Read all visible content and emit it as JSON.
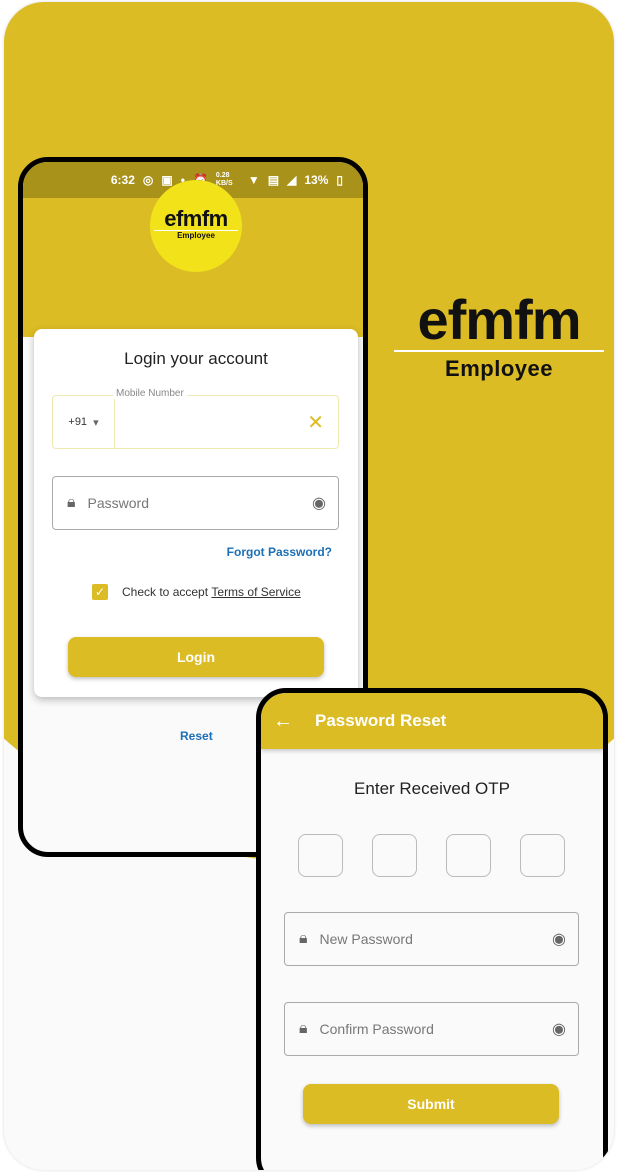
{
  "colors": {
    "accent": "#dcbc24",
    "link": "#1c6fb5"
  },
  "status_bar": {
    "time": "6:32",
    "speed": "0.28 KB/S",
    "battery": "13%"
  },
  "logo": {
    "brand": "efmfm",
    "sub": "Employee"
  },
  "login": {
    "title": "Login your account",
    "mobile_label": "Mobile Number",
    "country_code": "+91",
    "mobile_value": "",
    "password_placeholder": "Password",
    "forgot": "Forgot Password?",
    "accept_text": "Check to accept ",
    "terms": "Terms of Service",
    "checked": true,
    "login_button": "Login",
    "reset_link": "Reset"
  },
  "reset": {
    "title": "Password Reset",
    "otp_title": "Enter Received OTP",
    "new_password": "New Password",
    "confirm_password": "Confirm Password",
    "submit": "Submit"
  }
}
